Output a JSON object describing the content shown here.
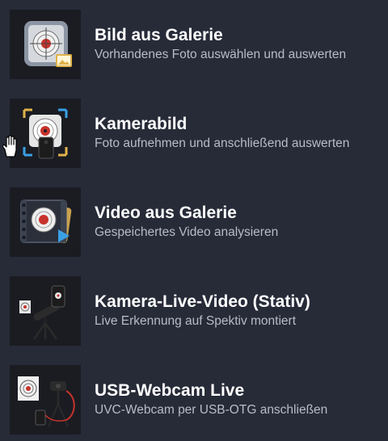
{
  "items": [
    {
      "title": "Bild aus Galerie",
      "subtitle": "Vorhandenes Foto auswählen und auswerten",
      "icon": "gallery-target-icon"
    },
    {
      "title": "Kamerabild",
      "subtitle": "Foto aufnehmen und anschließend auswerten",
      "icon": "camera-target-icon"
    },
    {
      "title": "Video aus Galerie",
      "subtitle": "Gespeichertes Video analysieren",
      "icon": "video-gallery-icon"
    },
    {
      "title": "Kamera-Live-Video (Stativ)",
      "subtitle": "Live Erkennung auf Spektiv montiert",
      "icon": "spotting-scope-tripod-icon"
    },
    {
      "title": "USB-Webcam Live",
      "subtitle": "UVC-Webcam per USB-OTG anschließen",
      "icon": "usb-webcam-icon"
    }
  ],
  "colors": {
    "background": "#272b38",
    "thumbnail_background": "#1a1c22",
    "title": "#ffffff",
    "subtitle": "#b9bcc6",
    "accent_gold": "#e0b24a",
    "accent_red": "#c8322c",
    "accent_blue": "#3aa0e6"
  },
  "cursor": {
    "icon": "hand-pointer-icon"
  }
}
